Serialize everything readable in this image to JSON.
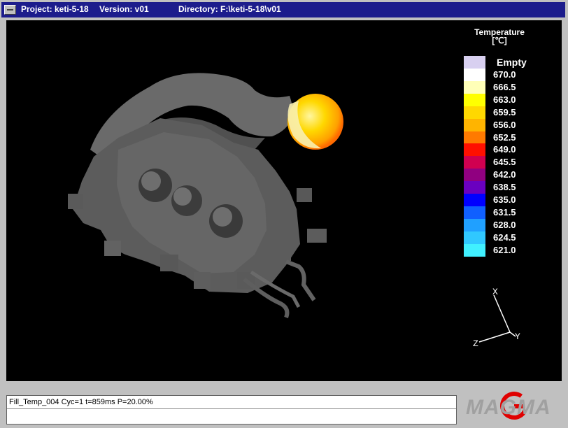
{
  "window": {
    "project": "Project: keti-5-18",
    "version": "Version: v01",
    "directory": "Directory: F:\\keti-5-18\\v01"
  },
  "legend": {
    "title_line1": "Temperature",
    "title_line2": "[℃]",
    "items": [
      {
        "label": "Empty",
        "color": "#d8d0f0"
      },
      {
        "label": "670.0",
        "color": "#ffffff"
      },
      {
        "label": "666.5",
        "color": "#ffffb8"
      },
      {
        "label": "663.0",
        "color": "#ffff00"
      },
      {
        "label": "659.5",
        "color": "#ffd800"
      },
      {
        "label": "656.0",
        "color": "#ffb400"
      },
      {
        "label": "652.5",
        "color": "#ff7a00"
      },
      {
        "label": "649.0",
        "color": "#ff1000"
      },
      {
        "label": "645.5",
        "color": "#d00050"
      },
      {
        "label": "642.0",
        "color": "#900080"
      },
      {
        "label": "638.5",
        "color": "#6a00c0"
      },
      {
        "label": "635.0",
        "color": "#0000ff"
      },
      {
        "label": "631.5",
        "color": "#1060ff"
      },
      {
        "label": "628.0",
        "color": "#20a0ff"
      },
      {
        "label": "624.5",
        "color": "#30c8ff"
      },
      {
        "label": "621.0",
        "color": "#40f0ff"
      }
    ]
  },
  "axes": {
    "x": "X",
    "y": "Y",
    "z": "Z"
  },
  "status": {
    "line1": "Fill_Temp_004 Cyc=1 t=859ms P=20.00%",
    "line2": ""
  },
  "logo": {
    "text": "MAGMA",
    "accent_color": "#e00000",
    "text_color": "#a0a0a0"
  }
}
